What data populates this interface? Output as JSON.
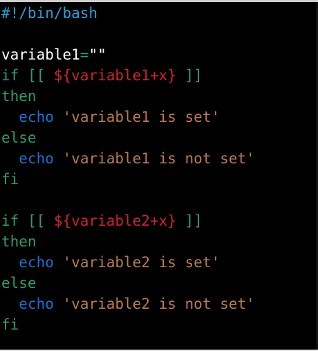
{
  "editor": {
    "lines": [
      {
        "tokens": [
          {
            "text": "#!/bin/bash",
            "kind": "shebang"
          }
        ]
      },
      {
        "tokens": []
      },
      {
        "tokens": [
          {
            "text": "variable1",
            "kind": "plain"
          },
          {
            "text": "=",
            "kind": "op"
          },
          {
            "text": "\"\"",
            "kind": "plain"
          }
        ]
      },
      {
        "tokens": [
          {
            "text": "if",
            "kind": "keyword"
          },
          {
            "text": " [[ ",
            "kind": "bracket"
          },
          {
            "text": "${variable1+x}",
            "kind": "var"
          },
          {
            "text": " ]]",
            "kind": "bracket"
          }
        ]
      },
      {
        "tokens": [
          {
            "text": "then",
            "kind": "keyword"
          }
        ]
      },
      {
        "tokens": [
          {
            "text": "  ",
            "kind": "plain"
          },
          {
            "text": "echo",
            "kind": "cmd"
          },
          {
            "text": " ",
            "kind": "plain"
          },
          {
            "text": "'variable1 is set'",
            "kind": "string"
          }
        ]
      },
      {
        "tokens": [
          {
            "text": "else",
            "kind": "keyword"
          }
        ]
      },
      {
        "tokens": [
          {
            "text": "  ",
            "kind": "plain"
          },
          {
            "text": "echo",
            "kind": "cmd"
          },
          {
            "text": " ",
            "kind": "plain"
          },
          {
            "text": "'variable1 is not set'",
            "kind": "string"
          }
        ]
      },
      {
        "tokens": [
          {
            "text": "fi",
            "kind": "keyword"
          }
        ]
      },
      {
        "tokens": []
      },
      {
        "tokens": [
          {
            "text": "if",
            "kind": "keyword"
          },
          {
            "text": " [[ ",
            "kind": "bracket"
          },
          {
            "text": "${variable2+x}",
            "kind": "var"
          },
          {
            "text": " ]]",
            "kind": "bracket"
          }
        ]
      },
      {
        "tokens": [
          {
            "text": "then",
            "kind": "keyword"
          }
        ]
      },
      {
        "tokens": [
          {
            "text": "  ",
            "kind": "plain"
          },
          {
            "text": "echo",
            "kind": "cmd"
          },
          {
            "text": " ",
            "kind": "plain"
          },
          {
            "text": "'variable2 is set'",
            "kind": "string"
          }
        ]
      },
      {
        "tokens": [
          {
            "text": "else",
            "kind": "keyword"
          }
        ]
      },
      {
        "tokens": [
          {
            "text": "  ",
            "kind": "plain"
          },
          {
            "text": "echo",
            "kind": "cmd"
          },
          {
            "text": " ",
            "kind": "plain"
          },
          {
            "text": "'variable2 is not set'",
            "kind": "string"
          }
        ]
      },
      {
        "tokens": [
          {
            "text": "fi",
            "kind": "keyword"
          }
        ]
      }
    ]
  },
  "colors": {
    "background": "#000000",
    "shebang": "#2a9fd6",
    "plain": "#ffffff",
    "keyword": "#2e9e72",
    "variable": "#d0232a",
    "command": "#1f6fd1",
    "string": "#bc7b4f"
  }
}
